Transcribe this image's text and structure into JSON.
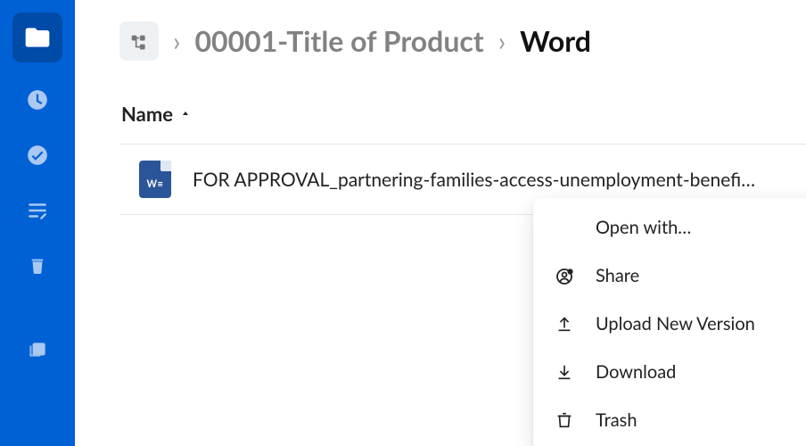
{
  "sidebar": {
    "items": [
      {
        "name": "files",
        "active": true
      },
      {
        "name": "recents",
        "active": false
      },
      {
        "name": "approved",
        "active": false
      },
      {
        "name": "notes",
        "active": false
      },
      {
        "name": "trash",
        "active": false
      },
      {
        "name": "collections",
        "active": false
      }
    ]
  },
  "breadcrumb": {
    "parent": "00001-Title of Product",
    "current": "Word"
  },
  "columns": {
    "name_label": "Name",
    "sort": "asc"
  },
  "files": [
    {
      "name": "FOR APPROVAL_partnering-families-access-unemployment-benefi…",
      "type": "word"
    }
  ],
  "context_menu": {
    "items": [
      {
        "key": "open_with",
        "label": "Open with…",
        "has_submenu": true
      },
      {
        "key": "share",
        "label": "Share"
      },
      {
        "key": "upload_new",
        "label": "Upload New Version"
      },
      {
        "key": "download",
        "label": "Download"
      },
      {
        "key": "trash",
        "label": "Trash"
      }
    ]
  },
  "colors": {
    "brand": "#0061d5",
    "brand_dark": "#004aa8"
  }
}
